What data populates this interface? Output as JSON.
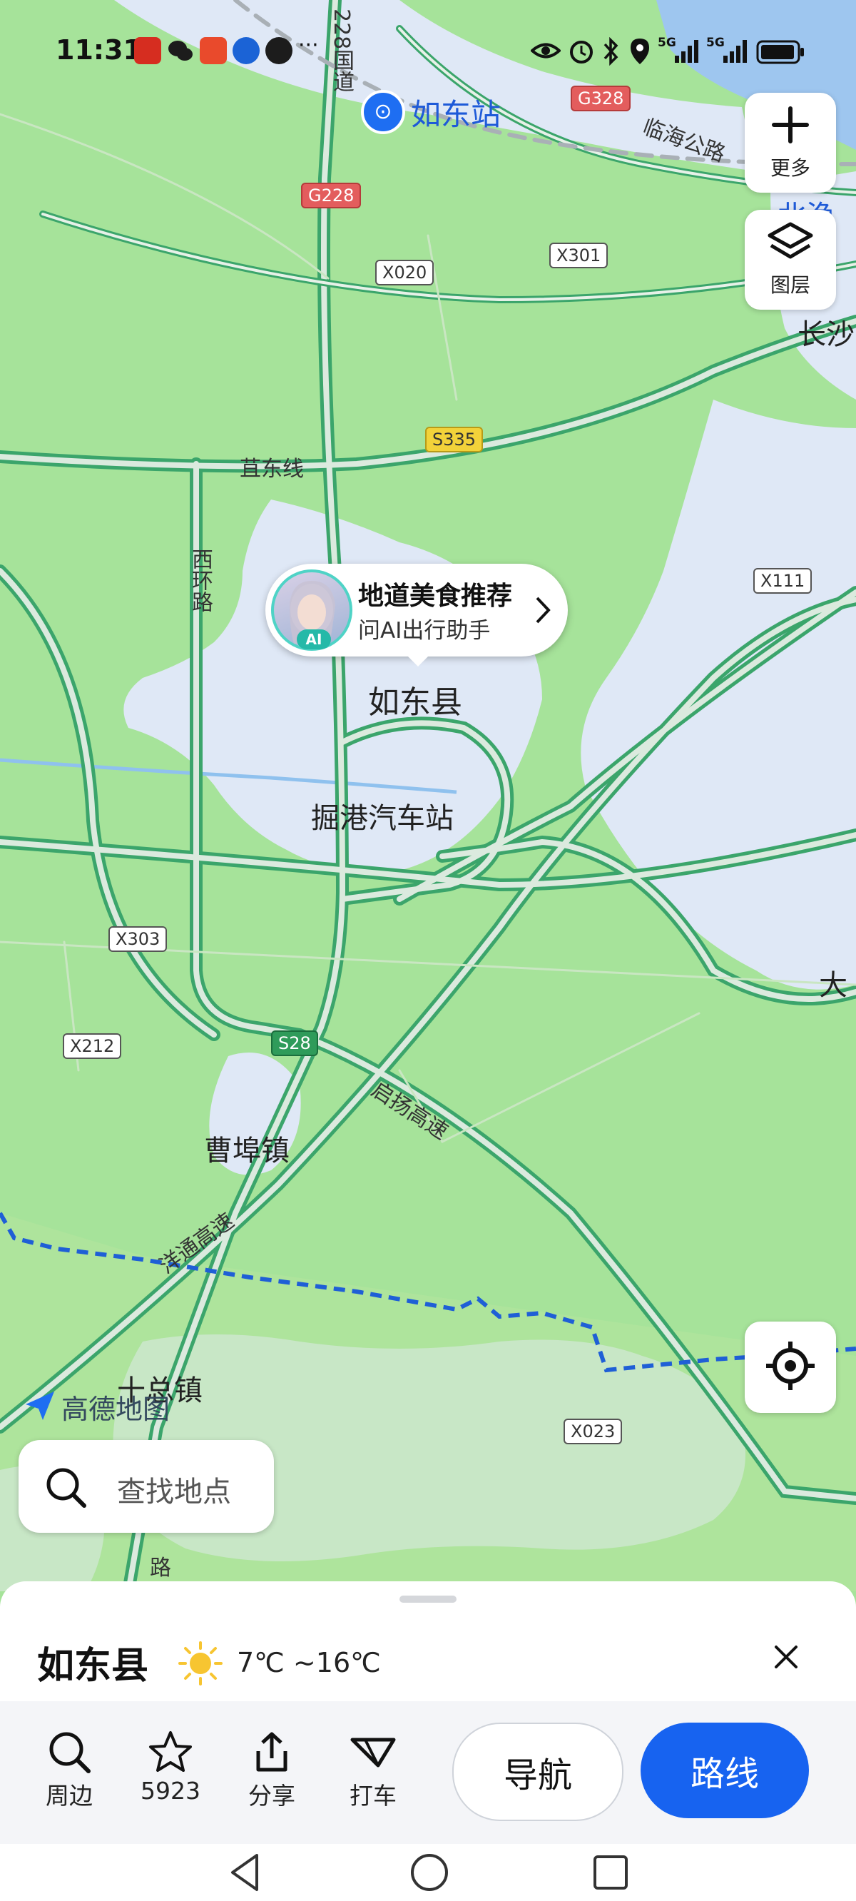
{
  "status_bar": {
    "time": "11:31",
    "dots": "···",
    "net_1": "5G",
    "net_2": "5G"
  },
  "map": {
    "places": {
      "rudong_station": "如东站",
      "rudong_county": "如东县",
      "juegang_bus": "掘港汽车站",
      "caobu": "曹埠镇",
      "shizong": "十总镇",
      "changsha_partial": "长沙",
      "da_partial": "大",
      "beiyu_partial": "北渔"
    },
    "shields": {
      "g328": "G328",
      "g228": "G228",
      "x020": "X020",
      "x301": "X301",
      "s335": "S335",
      "x111": "X111",
      "x303": "X303",
      "s28": "S28",
      "x212": "X212",
      "x023": "X023"
    },
    "road_labels": {
      "national_228": "228国道",
      "linhai": "临海公路",
      "judong": "苴东线",
      "xihuan": "西环路",
      "qiyang": "启扬高速",
      "yangtong": "洋通高速",
      "road_partial": "路"
    },
    "logo_text": "高德地图"
  },
  "controls": {
    "more_label": "更多",
    "layers_label": "图层"
  },
  "ai_bubble": {
    "title": "地道美食推荐",
    "subtitle": "问AI出行助手",
    "badge": "AI"
  },
  "search": {
    "placeholder": "查找地点"
  },
  "sheet": {
    "place_name": "如东县",
    "weather": "7℃ ~16℃",
    "actions": [
      {
        "label": "周边",
        "icon": "search-icon"
      },
      {
        "label": "5923",
        "icon": "star-icon"
      },
      {
        "label": "分享",
        "icon": "share-icon"
      },
      {
        "label": "打车",
        "icon": "taxi-icon"
      }
    ],
    "nav_label": "导航",
    "route_label": "路线"
  },
  "colors": {
    "land": "#a6e39a",
    "urban": "#dfe8f6",
    "road": "#3ba56b",
    "accent": "#1763f0",
    "boundary": "#1f5fd6"
  }
}
